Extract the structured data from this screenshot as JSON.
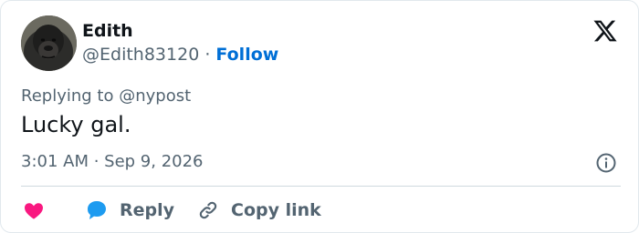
{
  "user": {
    "name": "Edith",
    "handle": "@Edith83120",
    "separator": "·",
    "follow_label": "Follow",
    "avatar_icon": "gorilla-avatar"
  },
  "tweet": {
    "replying_prefix": "Replying to",
    "replying_to": "@nypost",
    "text": "Lucky gal.",
    "timestamp": "3:01 AM · Sep 9, 2026"
  },
  "actions": {
    "like_icon": "heart-icon",
    "reply_label": "Reply",
    "reply_icon": "speech-bubble-icon",
    "copy_link_label": "Copy link",
    "copy_link_icon": "link-icon"
  },
  "colors": {
    "follow": "#006fd6",
    "like": "#f91880",
    "reply": "#1d9bf0",
    "muted": "#536471",
    "text": "#0f1419"
  }
}
